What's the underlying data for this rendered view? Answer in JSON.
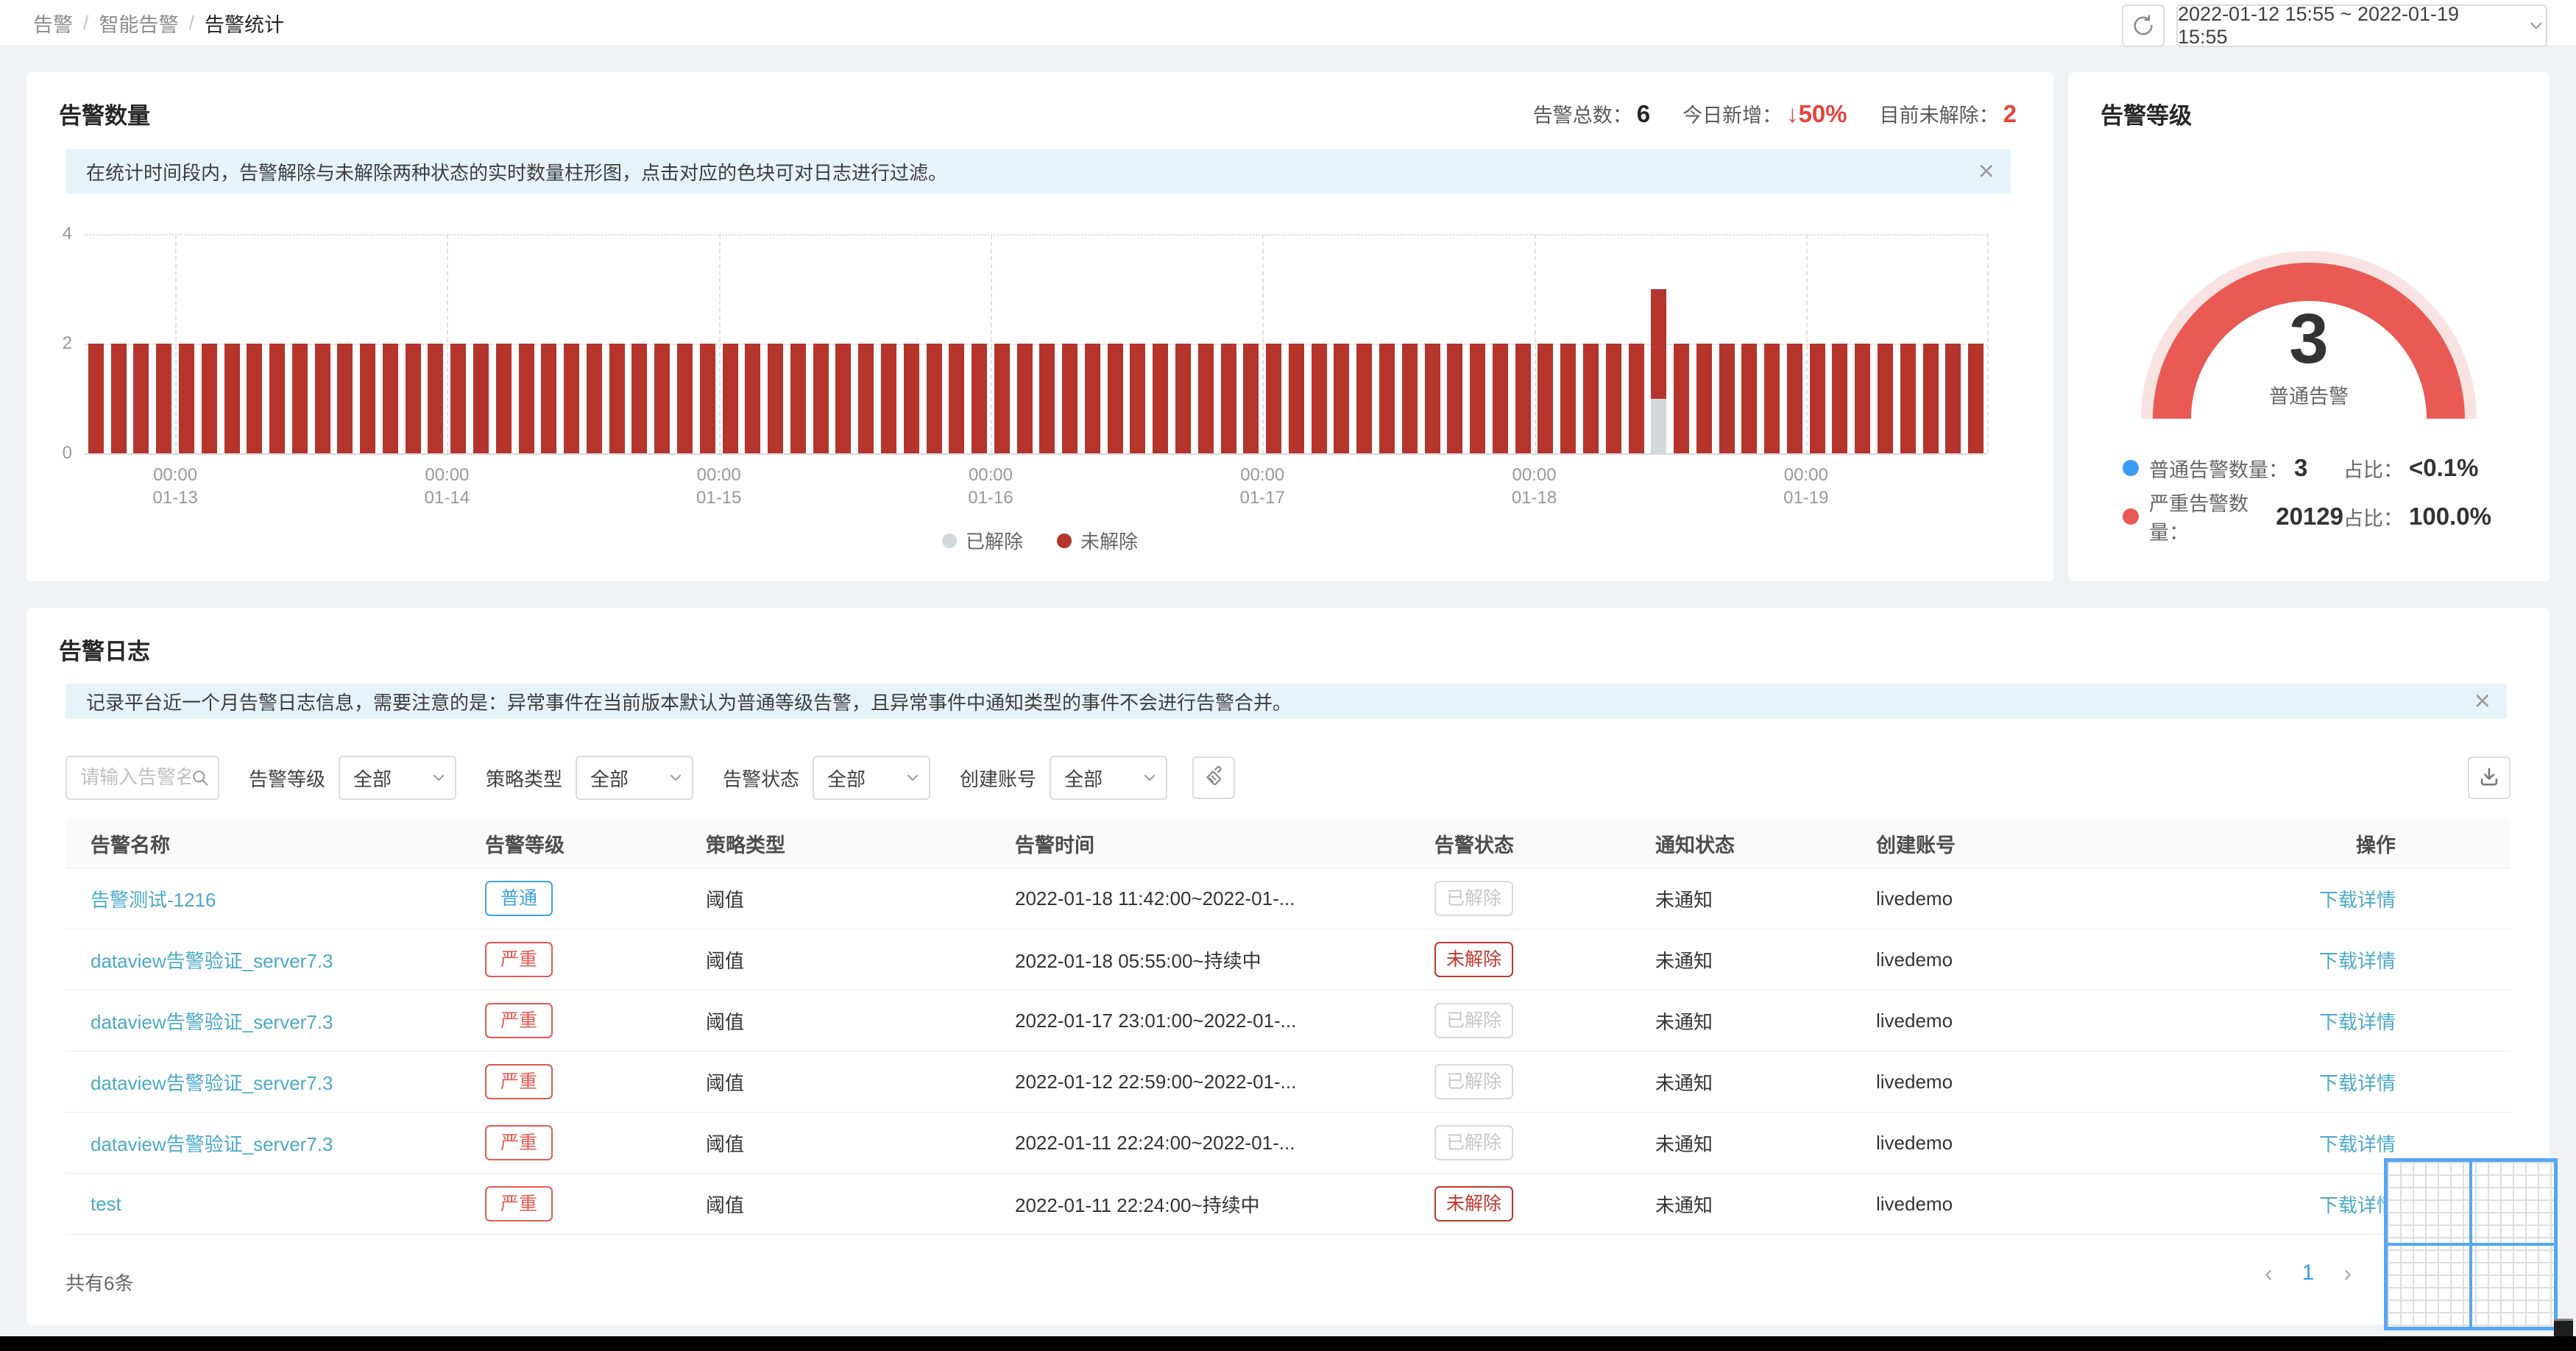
{
  "breadcrumb": {
    "separator": "/",
    "items": [
      "告警",
      "智能告警",
      "告警统计"
    ]
  },
  "toolbar": {
    "date_range": "2022-01-12 15:55 ~ 2022-01-19 15:55"
  },
  "icons": {
    "refresh": "circular-arrow",
    "chevron_down": "caret-down",
    "search": "magnifier",
    "clear_filter": "broom",
    "download": "tray-arrow",
    "close": "×",
    "prev": "‹",
    "next": "›"
  },
  "alert_count_panel": {
    "title": "告警数量",
    "stats": {
      "total_label": "告警总数：",
      "total_value": "6",
      "new_label": "今日新增：",
      "new_value": "↓50%",
      "unresolved_label": "目前未解除：",
      "unresolved_value": "2"
    },
    "banner": "在统计时间段内，告警解除与未解除两种状态的实时数量柱形图，点击对应的色块可对日志进行过滤。"
  },
  "chart_data": [
    {
      "type": "bar",
      "title": "告警数量",
      "stacked": true,
      "interval_hours": 2,
      "x_start": "2022-01-12 16:00",
      "x_end": "2022-01-19 16:00",
      "x_ticks": [
        {
          "time": "00:00",
          "date": "01-13"
        },
        {
          "time": "00:00",
          "date": "01-14"
        },
        {
          "time": "00:00",
          "date": "01-15"
        },
        {
          "time": "00:00",
          "date": "01-16"
        },
        {
          "time": "00:00",
          "date": "01-17"
        },
        {
          "time": "00:00",
          "date": "01-18"
        },
        {
          "time": "00:00",
          "date": "01-19"
        }
      ],
      "ylim": [
        0,
        4
      ],
      "y_ticks": [
        0,
        2,
        4
      ],
      "legend_position": "bottom",
      "series": [
        {
          "name": "已解除",
          "color": "#d2d9dc",
          "values": [
            0,
            0,
            0,
            0,
            0,
            0,
            0,
            0,
            0,
            0,
            0,
            0,
            0,
            0,
            0,
            0,
            0,
            0,
            0,
            0,
            0,
            0,
            0,
            0,
            0,
            0,
            0,
            0,
            0,
            0,
            0,
            0,
            0,
            0,
            0,
            0,
            0,
            0,
            0,
            0,
            0,
            0,
            0,
            0,
            0,
            0,
            0,
            0,
            0,
            0,
            0,
            0,
            0,
            0,
            0,
            0,
            0,
            0,
            0,
            0,
            0,
            0,
            0,
            0,
            0,
            0,
            0,
            0,
            0,
            1,
            0,
            0,
            0,
            0,
            0,
            0,
            0,
            0,
            0,
            0,
            0,
            0,
            0,
            0
          ]
        },
        {
          "name": "未解除",
          "color": "#b5342c",
          "values": [
            2,
            2,
            2,
            2,
            2,
            2,
            2,
            2,
            2,
            2,
            2,
            2,
            2,
            2,
            2,
            2,
            2,
            2,
            2,
            2,
            2,
            2,
            2,
            2,
            2,
            2,
            2,
            2,
            2,
            2,
            2,
            2,
            2,
            2,
            2,
            2,
            2,
            2,
            2,
            2,
            2,
            2,
            2,
            2,
            2,
            2,
            2,
            2,
            2,
            2,
            2,
            2,
            2,
            2,
            2,
            2,
            2,
            2,
            2,
            2,
            2,
            2,
            2,
            2,
            2,
            2,
            2,
            2,
            2,
            2,
            2,
            2,
            2,
            2,
            2,
            2,
            2,
            2,
            2,
            2,
            2,
            2,
            2,
            2
          ]
        }
      ]
    },
    {
      "type": "gauge",
      "title": "告警等级",
      "value": 3,
      "value_label": "普通告警",
      "arc_color": "#e95a54",
      "track_color": "#f9e3e2",
      "segments": [
        {
          "name": "普通告警数量",
          "value": 3,
          "ratio": "<0.1%",
          "color": "#3b9bf8"
        },
        {
          "name": "严重告警数量",
          "value": 20129,
          "ratio": "100.0%",
          "color": "#e95a54"
        }
      ]
    }
  ],
  "alert_level_panel": {
    "title": "告警等级",
    "gauge_value": "3",
    "gauge_label": "普通告警",
    "legend": [
      {
        "dot_color": "#3b9bf8",
        "label": "普通告警数量：",
        "value": "3",
        "ratio_label": "占比：",
        "ratio": "<0.1%"
      },
      {
        "dot_color": "#e95a54",
        "label": "严重告警数量：",
        "value": "20129",
        "ratio_label": "占比：",
        "ratio": "100.0%"
      }
    ]
  },
  "log_panel": {
    "title": "告警日志",
    "banner": "记录平台近一个月告警日志信息，需要注意的是：异常事件在当前版本默认为普通等级告警，且异常事件中通知类型的事件不会进行告警合并。",
    "search_placeholder": "请输入告警名称",
    "filters": [
      {
        "label": "告警等级",
        "value": "全部"
      },
      {
        "label": "策略类型",
        "value": "全部"
      },
      {
        "label": "告警状态",
        "value": "全部"
      },
      {
        "label": "创建账号",
        "value": "全部"
      }
    ],
    "table": {
      "columns": [
        "告警名称",
        "告警等级",
        "策略类型",
        "告警时间",
        "告警状态",
        "通知状态",
        "创建账号",
        "操作"
      ],
      "action_label": "下载详情",
      "rows": [
        {
          "name": "告警测试-1216",
          "level": "普通",
          "level_class": "normal",
          "policy": "阈值",
          "time": "2022-01-18 11:42:00~2022-01-...",
          "status": "已解除",
          "status_class": "resolved",
          "notify": "未通知",
          "account": "livedemo"
        },
        {
          "name": "dataview告警验证_server7.3",
          "level": "严重",
          "level_class": "severe",
          "policy": "阈值",
          "time": "2022-01-18 05:55:00~持续中",
          "status": "未解除",
          "status_class": "unresolved",
          "notify": "未通知",
          "account": "livedemo"
        },
        {
          "name": "dataview告警验证_server7.3",
          "level": "严重",
          "level_class": "severe",
          "policy": "阈值",
          "time": "2022-01-17 23:01:00~2022-01-...",
          "status": "已解除",
          "status_class": "resolved",
          "notify": "未通知",
          "account": "livedemo"
        },
        {
          "name": "dataview告警验证_server7.3",
          "level": "严重",
          "level_class": "severe",
          "policy": "阈值",
          "time": "2022-01-12 22:59:00~2022-01-...",
          "status": "已解除",
          "status_class": "resolved",
          "notify": "未通知",
          "account": "livedemo"
        },
        {
          "name": "dataview告警验证_server7.3",
          "level": "严重",
          "level_class": "severe",
          "policy": "阈值",
          "time": "2022-01-11 22:24:00~2022-01-...",
          "status": "已解除",
          "status_class": "resolved",
          "notify": "未通知",
          "account": "livedemo"
        },
        {
          "name": "test",
          "level": "严重",
          "level_class": "severe",
          "policy": "阈值",
          "time": "2022-01-11 22:24:00~持续中",
          "status": "未解除",
          "status_class": "unresolved",
          "notify": "未通知",
          "account": "livedemo"
        }
      ]
    },
    "footer": {
      "total": "共有6条",
      "page": "1"
    }
  }
}
